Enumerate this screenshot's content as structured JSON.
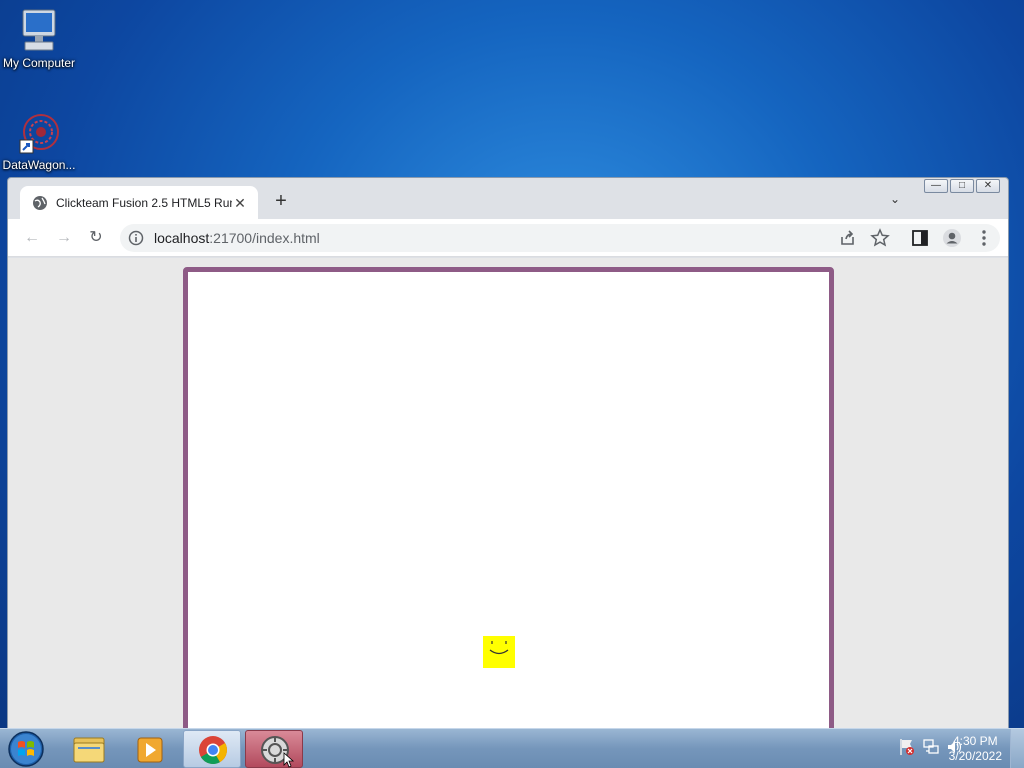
{
  "desktop": {
    "icons": [
      {
        "label": "My Computer"
      },
      {
        "label": "DataWagon..."
      }
    ]
  },
  "browser": {
    "tab_title": "Clickteam Fusion 2.5 HTML5 Run",
    "tab_close": "✕",
    "new_tab": "+",
    "tab_menu": "⌄",
    "back": "←",
    "forward": "→",
    "reload": "↻",
    "url_host": "localhost",
    "url_path": ":21700/index.html",
    "window_buttons": [
      "—",
      "□",
      "✕"
    ]
  },
  "taskbar": {
    "time": "4:30 PM",
    "date": "3/20/2022"
  },
  "colors": {
    "frame_border": "#8e5b86",
    "player": "#ffff00",
    "desktop": "#1565c0"
  }
}
